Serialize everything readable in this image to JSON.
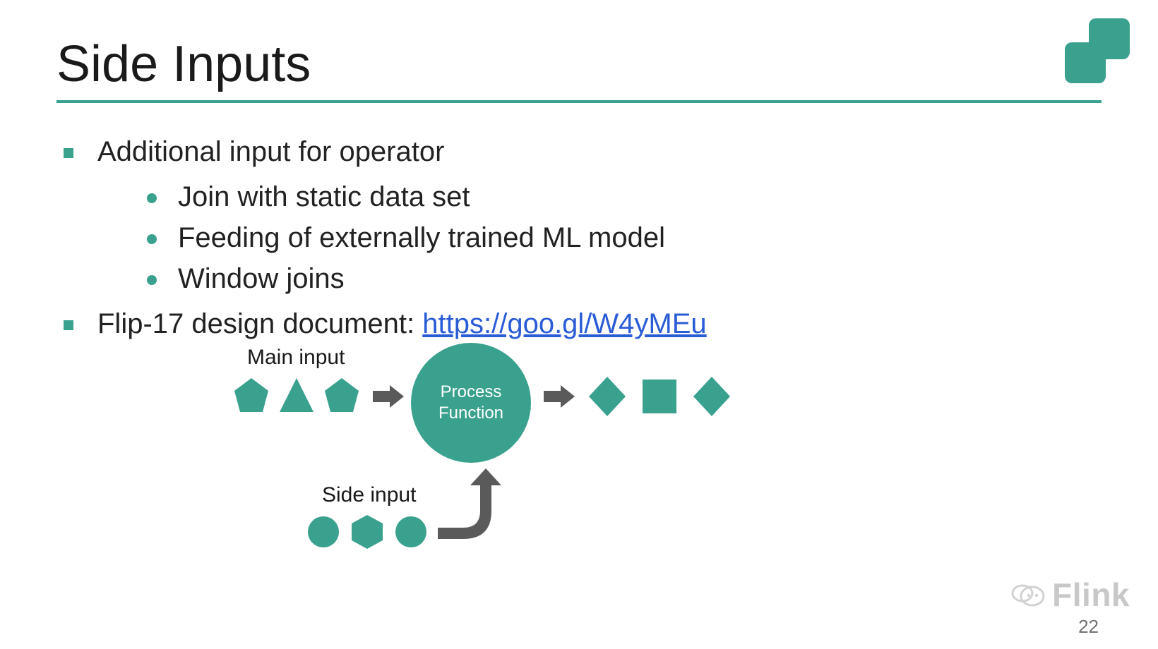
{
  "slide": {
    "title": "Side Inputs",
    "bullets": [
      {
        "text": "Additional input for operator",
        "children": [
          "Join with static data set",
          "Feeding of externally trained ML model",
          "Window joins"
        ]
      },
      {
        "text_prefix": "Flip-17 design document: ",
        "link_text": "https://goo.gl/W4yMEu",
        "link_href": "https://goo.gl/W4yMEu"
      }
    ]
  },
  "diagram": {
    "main_input_label": "Main input",
    "side_input_label": "Side input",
    "process_node_line1": "Process",
    "process_node_line2": "Function"
  },
  "footer": {
    "watermark": "Flink",
    "page_number": "22"
  },
  "colors": {
    "accent": "#3aa18e",
    "arrow": "#5a5a5a",
    "link": "#2a5cd6"
  }
}
